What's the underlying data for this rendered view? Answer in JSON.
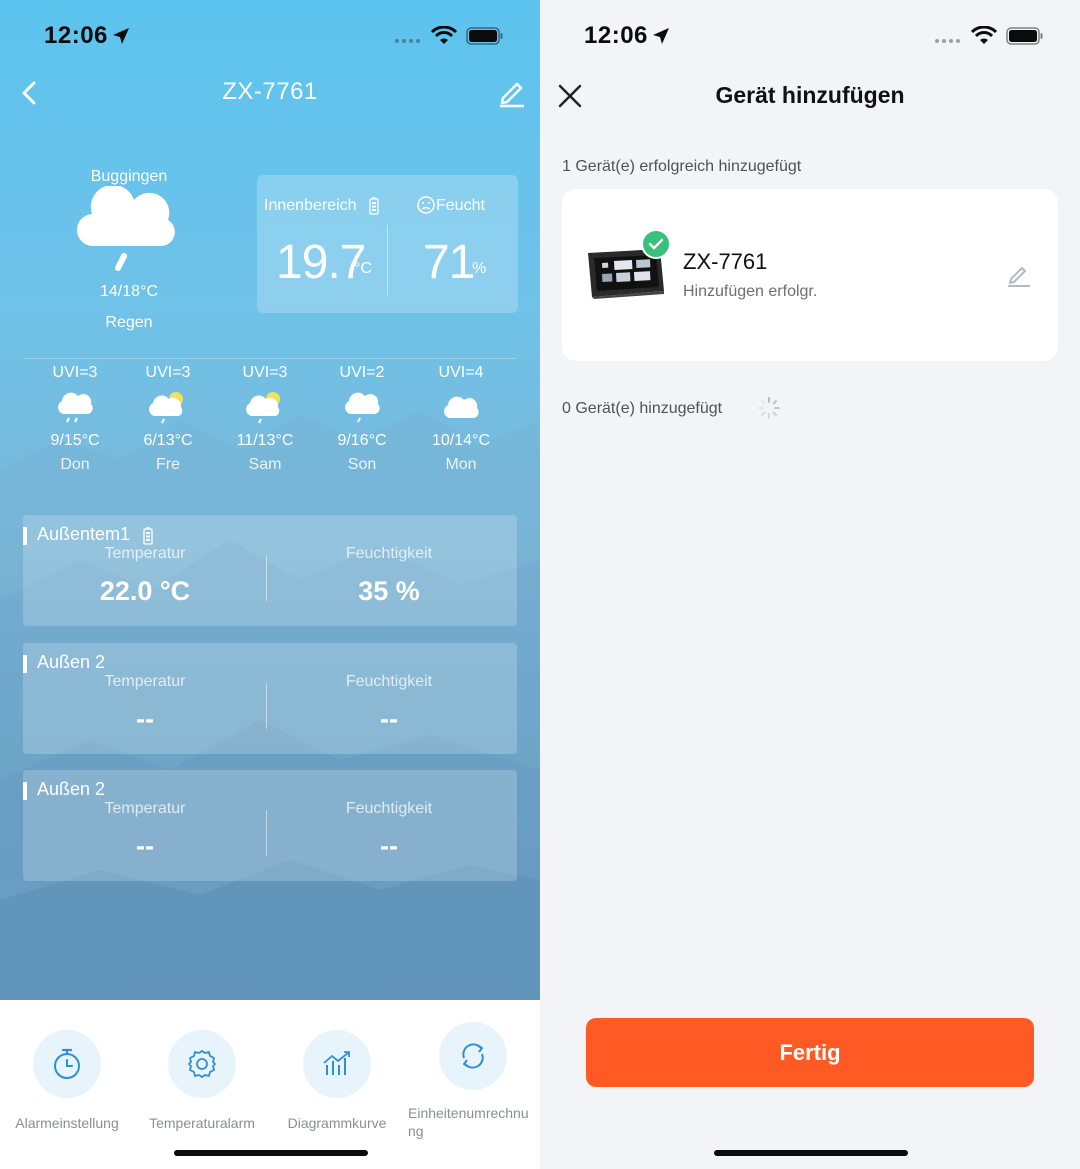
{
  "left": {
    "status": {
      "time": "12:06"
    },
    "device_title": "ZX-7761",
    "weather": {
      "city": "Buggingen",
      "range": "14/18°C",
      "condition": "Regen"
    },
    "indoor": {
      "label": "Innenbereich",
      "temp": "19.7",
      "temp_unit": "°C",
      "hum_label": "Feucht",
      "hum": "71",
      "hum_unit": "%"
    },
    "forecast": [
      {
        "uvi": "UVI=3",
        "temp": "9/15°C",
        "day": "Don",
        "icon": "rain-cloud-icon"
      },
      {
        "uvi": "UVI=3",
        "temp": "6/13°C",
        "day": "Fre",
        "icon": "sun-rain-cloud-icon"
      },
      {
        "uvi": "UVI=3",
        "temp": "11/13°C",
        "day": "Sam",
        "icon": "sun-rain-cloud-icon"
      },
      {
        "uvi": "UVI=2",
        "temp": "9/16°C",
        "day": "Son",
        "icon": "light-rain-cloud-icon"
      },
      {
        "uvi": "UVI=4",
        "temp": "10/14°C",
        "day": "Mon",
        "icon": "cloud-icon"
      }
    ],
    "sensors": [
      {
        "name": "Außentem1",
        "temp_label": "Temperatur",
        "temp": "22.0 °C",
        "hum_label": "Feuchtigkeit",
        "hum": "35 %"
      },
      {
        "name": "Außen 2",
        "temp_label": "Temperatur",
        "temp": "--",
        "hum_label": "Feuchtigkeit",
        "hum": "--"
      },
      {
        "name": "Außen 2",
        "temp_label": "Temperatur",
        "temp": "--",
        "hum_label": "Feuchtigkeit",
        "hum": "--"
      }
    ],
    "toolbar": [
      {
        "label": "Alarmeinstellung",
        "icon": "timer-icon"
      },
      {
        "label": "Temperaturalarm",
        "icon": "gear-icon"
      },
      {
        "label": "Diagrammkurve",
        "icon": "chart-icon"
      },
      {
        "label": "Einheitenumrechnu ng",
        "icon": "refresh-icon"
      }
    ]
  },
  "right": {
    "status": {
      "time": "12:06"
    },
    "title": "Gerät hinzufügen",
    "success_text": "1 Gerät(e) erfolgreich hinzugefügt",
    "device": {
      "name": "ZX-7761",
      "status": "Hinzufügen erfolgr."
    },
    "added_text": "0 Gerät(e) hinzugefügt",
    "done_label": "Fertig"
  },
  "colors": {
    "accent": "#ff5a23",
    "success": "#39c07b",
    "sky_top": "#5cc4ef"
  }
}
